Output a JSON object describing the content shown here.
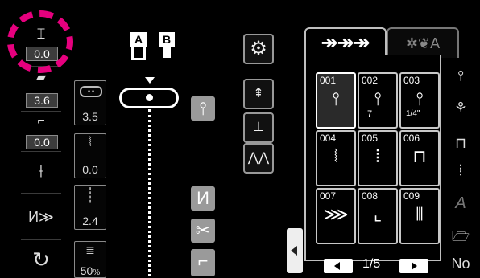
{
  "left_strip": {
    "stitch_width": "0.0",
    "stitch_length": "3.6",
    "presser_foot_height": "0.0"
  },
  "settings": {
    "thread_tension": "3.5",
    "zigzag_width": "0.0",
    "stitch_length": "2.4",
    "speed": "50",
    "speed_unit": "%"
  },
  "feet": {
    "a": "A",
    "b": "B"
  },
  "tabs": {
    "utility_label": "utility-stitches",
    "decorative_label": "decorative-stitches"
  },
  "stitches": [
    {
      "no": "001",
      "glyph": "⫯",
      "sub": ""
    },
    {
      "no": "002",
      "glyph": "⫯",
      "sub": "7"
    },
    {
      "no": "003",
      "glyph": "⫯",
      "sub": "1/4\""
    },
    {
      "no": "004",
      "glyph": "⦚",
      "sub": ""
    },
    {
      "no": "005",
      "glyph": "⦙",
      "sub": ""
    },
    {
      "no": "006",
      "glyph": "⊓",
      "sub": ""
    },
    {
      "no": "007",
      "glyph": "⋙",
      "sub": ""
    },
    {
      "no": "008",
      "glyph": "⌞",
      "sub": ""
    },
    {
      "no": "009",
      "glyph": "⦀",
      "sub": ""
    }
  ],
  "pager": {
    "page": "1/5"
  },
  "right_strip": {
    "letter": "A",
    "no_label": "No"
  },
  "colors": {
    "highlight": "#e6007e",
    "panel_border": "#bfbfbf"
  }
}
